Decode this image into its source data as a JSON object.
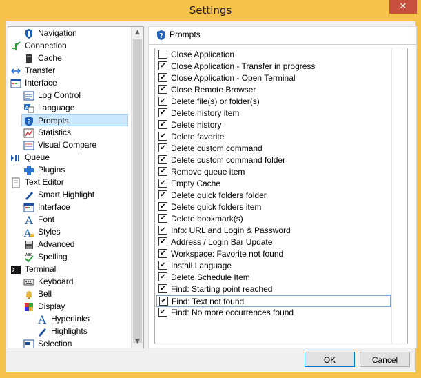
{
  "window": {
    "title": "Settings",
    "close_glyph": "✕"
  },
  "tree": {
    "items": [
      {
        "label": "Navigation",
        "icon": "navigation-icon",
        "indent": 1
      },
      {
        "label": "Connection",
        "icon": "connection-icon",
        "indent": 0
      },
      {
        "label": "Cache",
        "icon": "cache-icon",
        "indent": 1
      },
      {
        "label": "Transfer",
        "icon": "transfer-icon",
        "indent": 0
      },
      {
        "label": "Interface",
        "icon": "interface-icon",
        "indent": 0
      },
      {
        "label": "Log Control",
        "icon": "log-control-icon",
        "indent": 1
      },
      {
        "label": "Language",
        "icon": "language-icon",
        "indent": 1
      },
      {
        "label": "Prompts",
        "icon": "prompts-icon",
        "indent": 1,
        "selected": true
      },
      {
        "label": "Statistics",
        "icon": "statistics-icon",
        "indent": 1
      },
      {
        "label": "Visual Compare",
        "icon": "visual-compare-icon",
        "indent": 1
      },
      {
        "label": "Queue",
        "icon": "queue-icon",
        "indent": 0
      },
      {
        "label": "Plugins",
        "icon": "plugins-icon",
        "indent": 1
      },
      {
        "label": "Text Editor",
        "icon": "text-editor-icon",
        "indent": 0
      },
      {
        "label": "Smart Highlight",
        "icon": "smart-highlight-icon",
        "indent": 1
      },
      {
        "label": "Interface",
        "icon": "interface-icon",
        "indent": 1
      },
      {
        "label": "Font",
        "icon": "font-icon",
        "indent": 1
      },
      {
        "label": "Styles",
        "icon": "styles-icon",
        "indent": 1
      },
      {
        "label": "Advanced",
        "icon": "advanced-icon",
        "indent": 1
      },
      {
        "label": "Spelling",
        "icon": "spelling-icon",
        "indent": 1
      },
      {
        "label": "Terminal",
        "icon": "terminal-icon",
        "indent": 0
      },
      {
        "label": "Keyboard",
        "icon": "keyboard-icon",
        "indent": 1
      },
      {
        "label": "Bell",
        "icon": "bell-icon",
        "indent": 1
      },
      {
        "label": "Display",
        "icon": "display-icon",
        "indent": 1
      },
      {
        "label": "Hyperlinks",
        "icon": "hyperlinks-icon",
        "indent": 2
      },
      {
        "label": "Highlights",
        "icon": "highlights-icon",
        "indent": 2
      },
      {
        "label": "Selection",
        "icon": "selection-icon",
        "indent": 1
      }
    ]
  },
  "panel": {
    "title": "Prompts",
    "items": [
      {
        "label": "Close Application",
        "checked": false
      },
      {
        "label": "Close Application - Transfer in progress",
        "checked": true
      },
      {
        "label": "Close Application - Open Terminal",
        "checked": true
      },
      {
        "label": "Close Remote Browser",
        "checked": true
      },
      {
        "label": "Delete file(s) or folder(s)",
        "checked": true
      },
      {
        "label": "Delete history item",
        "checked": true
      },
      {
        "label": "Delete history",
        "checked": true
      },
      {
        "label": "Delete favorite",
        "checked": true
      },
      {
        "label": "Delete custom command",
        "checked": true
      },
      {
        "label": "Delete custom command folder",
        "checked": true
      },
      {
        "label": "Remove queue item",
        "checked": true
      },
      {
        "label": "Empty Cache",
        "checked": true
      },
      {
        "label": "Delete quick folders folder",
        "checked": true
      },
      {
        "label": "Delete quick folders item",
        "checked": true
      },
      {
        "label": "Delete bookmark(s)",
        "checked": true
      },
      {
        "label": "Info: URL and Login & Password",
        "checked": true
      },
      {
        "label": "Address / Login Bar Update",
        "checked": true
      },
      {
        "label": "Workspace: Favorite not found",
        "checked": true
      },
      {
        "label": "Install Language",
        "checked": true
      },
      {
        "label": "Delete Schedule Item",
        "checked": true
      },
      {
        "label": "Find: Starting point reached",
        "checked": true
      },
      {
        "label": "Find: Text not found",
        "checked": true,
        "focused": true
      },
      {
        "label": "Find: No more occurrences found",
        "checked": true
      }
    ]
  },
  "buttons": {
    "ok": "OK",
    "cancel": "Cancel"
  },
  "colors": {
    "title_bar": "#f6c24a",
    "close": "#c7503f",
    "selection": "#cce8ff"
  }
}
